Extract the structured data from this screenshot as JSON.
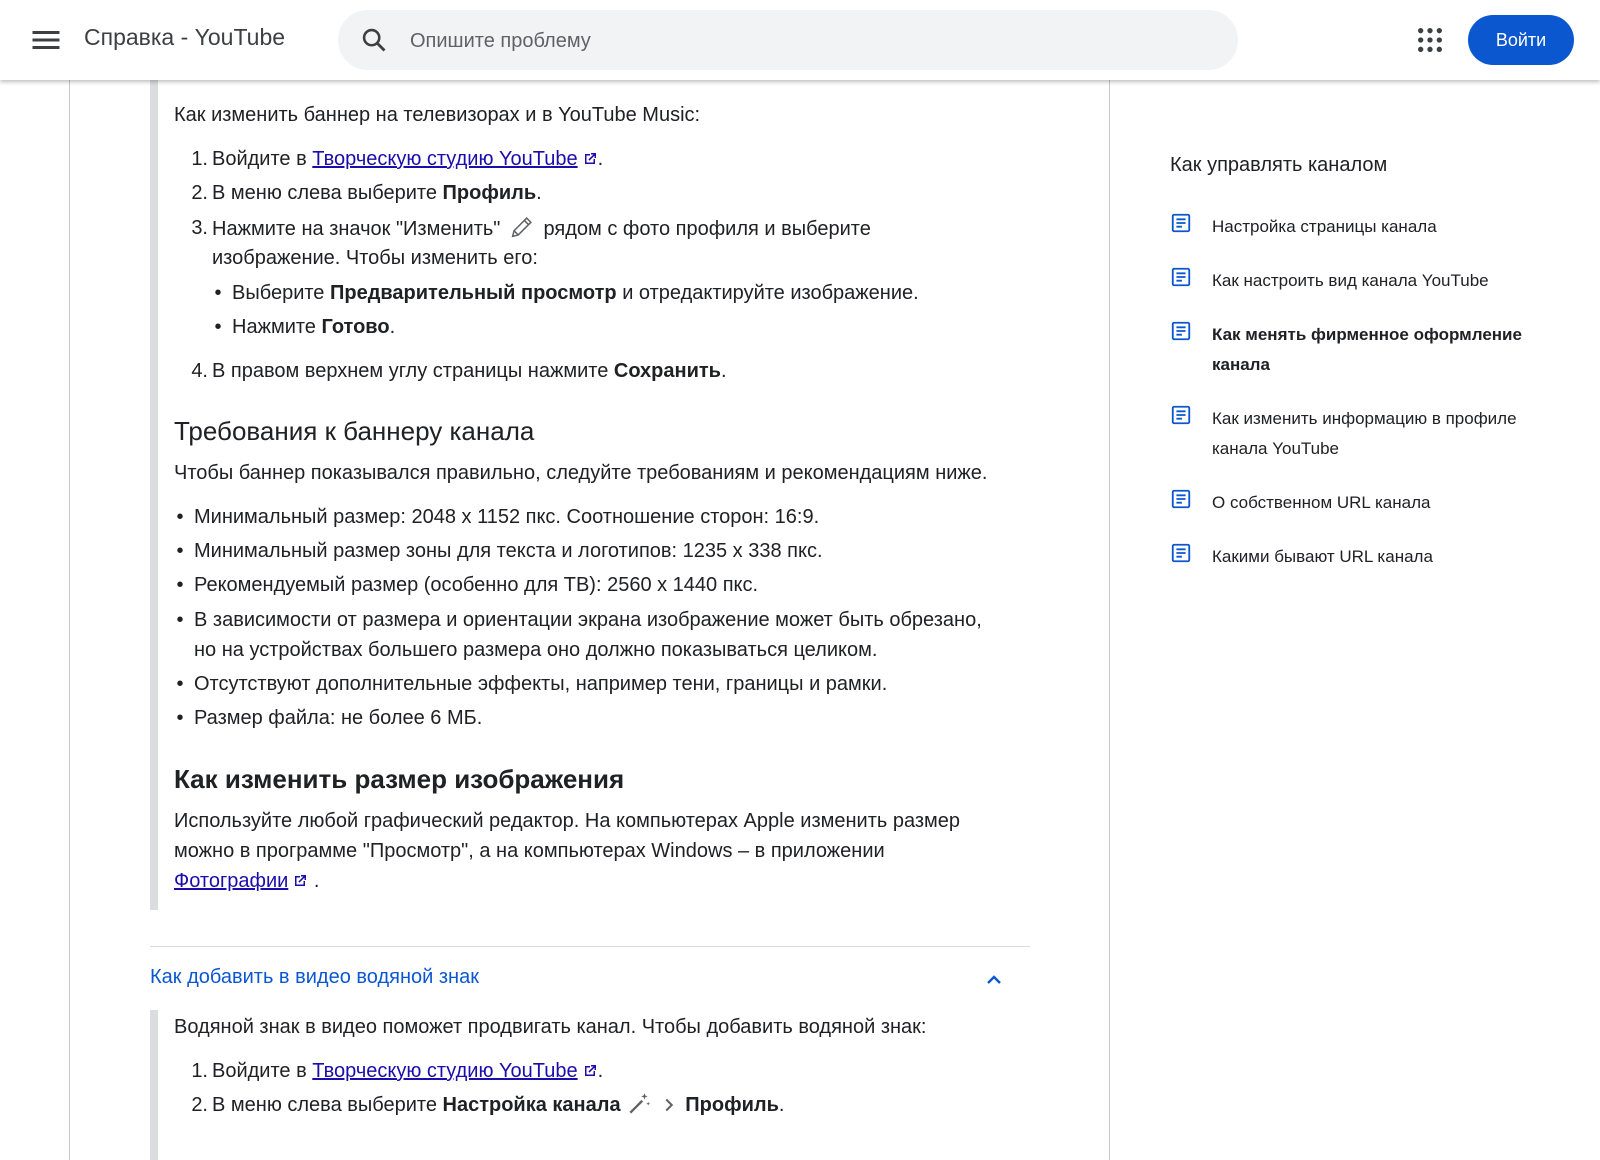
{
  "header": {
    "site_title": "Справка - YouTube",
    "search_placeholder": "Опишите проблему",
    "signin_label": "Войти",
    "icons": {
      "menu": "menu-icon",
      "search": "search-icon",
      "apps": "apps-grid-icon"
    },
    "colors": {
      "signin_bg": "#0b57d0",
      "search_bg": "#f1f3f4"
    }
  },
  "article": {
    "tv_intro": "Как изменить баннер на телевизорах и в YouTube Music:",
    "tv_steps": {
      "s1_num": "1.",
      "s1_pre": "Войдите в",
      "s1_link": "Творческую студию YouTube",
      "s1_post": ".",
      "s2_num": "2.",
      "s2_pre": "В меню слева выберите",
      "s2_bold": "Профиль",
      "s2_post": ".",
      "s3_num": "3.",
      "s3_line1_pre": "Нажмите на значок \"Изменить\"",
      "s3_line1_post": "рядом с фото профиля и выберите",
      "s3_line2": "изображение. Чтобы изменить его:",
      "sub1_pre": "Выберите",
      "sub1_bold": "Предварительный просмотр",
      "sub1_post": "и отредактируйте изображение.",
      "sub2_pre": "Нажмите",
      "sub2_bold": "Готово",
      "sub2_post": ".",
      "s4_num": "4.",
      "s4_pre": "В правом верхнем углу страницы нажмите",
      "s4_bold": "Сохранить",
      "s4_post": "."
    },
    "requirements": {
      "heading": "Требования к баннеру канала",
      "intro": "Чтобы баннер показывался правильно, следуйте требованиям и рекомендациям ниже.",
      "items": [
        "Минимальный размер: 2048 x 1152 пкс. Соотношение сторон: 16:9.",
        "Минимальный размер зоны для текста и логотипов: 1235 x 338 пкс.",
        "Рекомендуемый размер (особенно для ТВ): 2560 x 1440 пкс.",
        "В зависимости от размера и ориентации экрана изображение может быть обрезано,",
        "но на устройствах большего размера оно должно показываться целиком.",
        "Отсутствуют дополнительные эффекты, например тени, границы и рамки.",
        "Размер файла: не более 6 МБ."
      ]
    },
    "resize": {
      "heading": "Как изменить размер изображения",
      "line1": "Используйте любой графический редактор. На компьютерах Apple изменить размер",
      "line2": "можно в программе \"Просмотр\", а на компьютерах Windows – в приложении",
      "link": "Фотографии",
      "post": "."
    },
    "watermark": {
      "title": "Как добавить в видео водяной знак",
      "intro": "Водяной знак в видео поможет продвигать канал. Чтобы добавить водяной знак:",
      "s1_num": "1.",
      "s1_pre": "Войдите в",
      "s1_link": "Творческую студию YouTube",
      "s1_post": ".",
      "s2_num": "2.",
      "s2_pre": "В меню слева выберите",
      "s2_bold": "Настройка канала",
      "s2_bold2": "Профиль",
      "s2_post": "."
    },
    "icons": {
      "edit": "pencil-icon",
      "external": "external-link-icon",
      "customize": "magic-wand-icon",
      "chevron": "chevron-up-icon"
    },
    "colors": {
      "link": "#1a0dab",
      "accordion_title": "#0b57d0",
      "rule": "#dadce0"
    }
  },
  "sidebar": {
    "title": "Как управлять каналом",
    "items": [
      {
        "line1": "Настройка страницы канала",
        "line2": ""
      },
      {
        "line1": "Как настроить вид канала YouTube",
        "line2": ""
      },
      {
        "line1": "Как менять фирменное оформление",
        "line2": "канала",
        "active": true
      },
      {
        "line1": "Как изменить информацию в профиле",
        "line2": "канала YouTube"
      },
      {
        "line1": "О собственном URL канала",
        "line2": ""
      },
      {
        "line1": "Какими бывают URL канала",
        "line2": ""
      }
    ],
    "icon": "article-icon",
    "colors": {
      "icon": "#0b57d0"
    }
  }
}
